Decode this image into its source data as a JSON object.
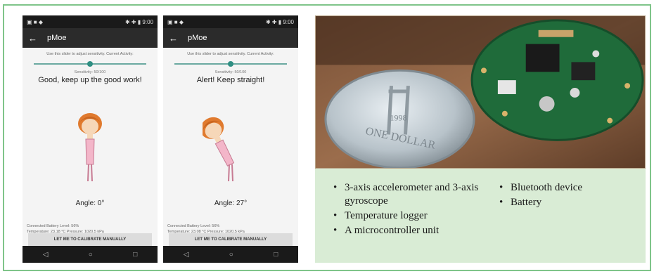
{
  "phones": [
    {
      "status_left": "▣ ■ ◆",
      "status_right": "✱ ✚ ▮ 9:00",
      "app_title": "pMoe",
      "hint": "Use this slider to adjust sensitivity.  Current Activity:",
      "sensitivity": "Sensitivity: 50/100",
      "message": "Good, keep up the good work!",
      "angle_label": "Angle: 0°",
      "info_line1": "Connected        Battery Level: 56%",
      "info_line2": "Temperature: 23.18 °C Pressure: 1020.5 kPa",
      "calibrate_label": "LET ME TO CALIBRATE MANUALLY",
      "slider_fraction": 0.5,
      "posture": "upright"
    },
    {
      "status_left": "▣ ■ ◆",
      "status_right": "✱ ✚ ▮ 9:00",
      "app_title": "pMoe",
      "hint": "Use this slider to adjust sensitivity.  Current Activity:",
      "sensitivity": "Sensitivity: 50/100",
      "message": "Alert! Keep straight!",
      "angle_label": "Angle: 27°",
      "info_line1": "Connected        Battery Level: 56%",
      "info_line2": "Temperature: 23.08 °C Pressure: 1020.5 kPa",
      "calibrate_label": "LET ME TO CALIBRATE MANUALLY",
      "slider_fraction": 0.5,
      "posture": "bent"
    }
  ],
  "nav_icons": [
    "back-triangle-icon",
    "home-circle-icon",
    "recents-square-icon"
  ],
  "photo": {
    "coin_text_top": "1998",
    "coin_text_bottom": "ONE DOLLAR"
  },
  "bullets_left": [
    "3-axis accelerometer and 3-axis gyroscope",
    "Temperature logger",
    "A microcontroller unit"
  ],
  "bullets_right": [
    "Bluetooth device",
    "Battery"
  ],
  "colors": {
    "frame_border": "#7fc48a",
    "bullet_panel": "#d9ecd5",
    "slider_accent": "#2f8f83",
    "pcb_green": "#1f6b3a"
  }
}
